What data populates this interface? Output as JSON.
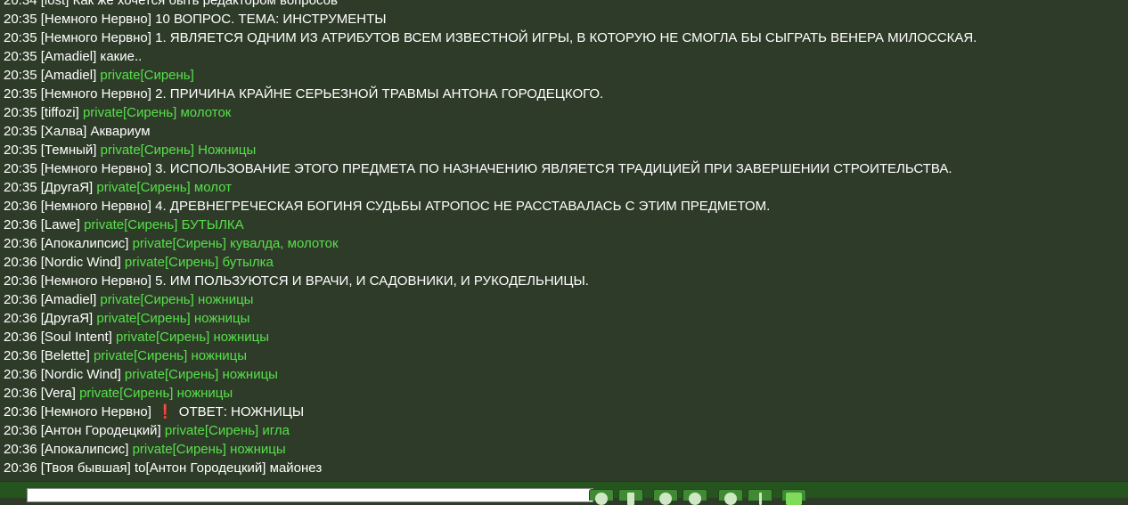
{
  "chat": {
    "messages": [
      {
        "time": "20:34",
        "nick": "[lost]",
        "priv": "",
        "to": "",
        "alert": "",
        "text": "Как же хочется быть редактором вопросов"
      },
      {
        "time": "20:35",
        "nick": "[Немного Нервно]",
        "priv": "",
        "to": "",
        "alert": "",
        "text": "10 ВОПРОС. ТЕМА: ИНСТРУМЕНТЫ"
      },
      {
        "time": "20:35",
        "nick": "[Немного Нервно]",
        "priv": "",
        "to": "",
        "alert": "",
        "text": "1. ЯВЛЯЕТСЯ ОДНИМ ИЗ АТРИБУТОВ ВСЕМ ИЗВЕСТНОЙ ИГРЫ, В КОТОРУЮ НЕ СМОГЛА БЫ СЫГРАТЬ ВЕНЕРА МИЛОССКАЯ."
      },
      {
        "time": "20:35",
        "nick": "[Amadiel]",
        "priv": "",
        "to": "",
        "alert": "",
        "text": "какие.."
      },
      {
        "time": "20:35",
        "nick": "[Amadiel]",
        "priv": "private[Сирень]",
        "to": "",
        "alert": "",
        "text": ""
      },
      {
        "time": "20:35",
        "nick": "[Немного Нервно]",
        "priv": "",
        "to": "",
        "alert": "",
        "text": "2. ПРИЧИНА КРАЙНЕ СЕРЬЕЗНОЙ ТРАВМЫ АНТОНА ГОРОДЕЦКОГО."
      },
      {
        "time": "20:35",
        "nick": "[tiffozi]",
        "priv": "private[Сирень] молоток",
        "to": "",
        "alert": "",
        "text": ""
      },
      {
        "time": "20:35",
        "nick": "[Халва]",
        "priv": "",
        "to": "",
        "alert": "",
        "text": "Аквариум"
      },
      {
        "time": "20:35",
        "nick": "[Темный]",
        "priv": "private[Сирень] Ножницы",
        "to": "",
        "alert": "",
        "text": ""
      },
      {
        "time": "20:35",
        "nick": "[Немного Нервно]",
        "priv": "",
        "to": "",
        "alert": "",
        "text": "3. ИСПОЛЬЗОВАНИЕ ЭТОГО ПРЕДМЕТА ПО НАЗНАЧЕНИЮ ЯВЛЯЕТСЯ ТРАДИЦИЕЙ ПРИ ЗАВЕРШЕНИИ СТРОИТЕЛЬСТВА."
      },
      {
        "time": "20:35",
        "nick": "[ДругаЯ]",
        "priv": "private[Сирень] молот",
        "to": "",
        "alert": "",
        "text": ""
      },
      {
        "time": "20:36",
        "nick": "[Немного Нервно]",
        "priv": "",
        "to": "",
        "alert": "",
        "text": "4. ДРЕВНЕГРЕЧЕСКАЯ БОГИНЯ СУДЬБЫ АТРОПОС НЕ РАССТАВАЛАСЬ С ЭТИМ ПРЕДМЕТОМ."
      },
      {
        "time": "20:36",
        "nick": "[Lawe]",
        "priv": "private[Сирень] БУТЫЛКА",
        "to": "",
        "alert": "",
        "text": ""
      },
      {
        "time": "20:36",
        "nick": "[Апокалипсис]",
        "priv": "private[Сирень] кувалда, молоток",
        "to": "",
        "alert": "",
        "text": ""
      },
      {
        "time": "20:36",
        "nick": "[Nordic Wind]",
        "priv": "private[Сирень] бутылка",
        "to": "",
        "alert": "",
        "text": ""
      },
      {
        "time": "20:36",
        "nick": "[Немного Нервно]",
        "priv": "",
        "to": "",
        "alert": "",
        "text": "5. ИМ ПОЛЬЗУЮТСЯ И ВРАЧИ, И САДОВНИКИ, И РУКОДЕЛЬНИЦЫ."
      },
      {
        "time": "20:36",
        "nick": "[Amadiel]",
        "priv": "private[Сирень] ножницы",
        "to": "",
        "alert": "",
        "text": ""
      },
      {
        "time": "20:36",
        "nick": "[ДругаЯ]",
        "priv": "private[Сирень] ножницы",
        "to": "",
        "alert": "",
        "text": ""
      },
      {
        "time": "20:36",
        "nick": "[Soul Intent]",
        "priv": "private[Сирень] ножницы",
        "to": "",
        "alert": "",
        "text": ""
      },
      {
        "time": "20:36",
        "nick": "[Belette]",
        "priv": "private[Сирень] ножницы",
        "to": "",
        "alert": "",
        "text": ""
      },
      {
        "time": "20:36",
        "nick": "[Nordic Wind]",
        "priv": "private[Сирень] ножницы",
        "to": "",
        "alert": "",
        "text": ""
      },
      {
        "time": "20:36",
        "nick": "[Vera]",
        "priv": "private[Сирень] ножницы",
        "to": "",
        "alert": "",
        "text": ""
      },
      {
        "time": "20:36",
        "nick": "[Немного Нервно]",
        "priv": "",
        "to": "",
        "alert": "❗",
        "text": "ОТВЕТ: НОЖНИЦЫ"
      },
      {
        "time": "20:36",
        "nick": "[Антон Городецкий]",
        "priv": "private[Сирень] игла",
        "to": "",
        "alert": "",
        "text": ""
      },
      {
        "time": "20:36",
        "nick": "[Апокалипсис]",
        "priv": "private[Сирень] ножницы",
        "to": "",
        "alert": "",
        "text": ""
      },
      {
        "time": "20:36",
        "nick": "[Твоя бывшая]",
        "priv": "",
        "to": "to[Антон Городецкий]",
        "alert": "",
        "text": "майонез"
      }
    ]
  },
  "input": {
    "value": "",
    "placeholder": ""
  },
  "toolbar": {
    "buttons": [
      {
        "name": "smiley-button",
        "icon": "smiley-icon",
        "kind": "round"
      },
      {
        "name": "document-button",
        "icon": "document-icon",
        "kind": "doc"
      },
      {
        "name": "globe-button",
        "icon": "globe-icon",
        "kind": "round"
      },
      {
        "name": "refresh-button",
        "icon": "refresh-icon",
        "kind": "round"
      },
      {
        "name": "lock-button",
        "icon": "lock-icon",
        "kind": "round"
      },
      {
        "name": "info-button",
        "icon": "info-icon",
        "kind": "info"
      },
      {
        "name": "signal-button",
        "icon": "signal-meter-icon",
        "kind": "bar"
      }
    ]
  },
  "colors": {
    "background": "#2f3b29",
    "private_text": "#55e04a",
    "alert": "#e0262a",
    "toolbar_bg": "#25541f"
  }
}
